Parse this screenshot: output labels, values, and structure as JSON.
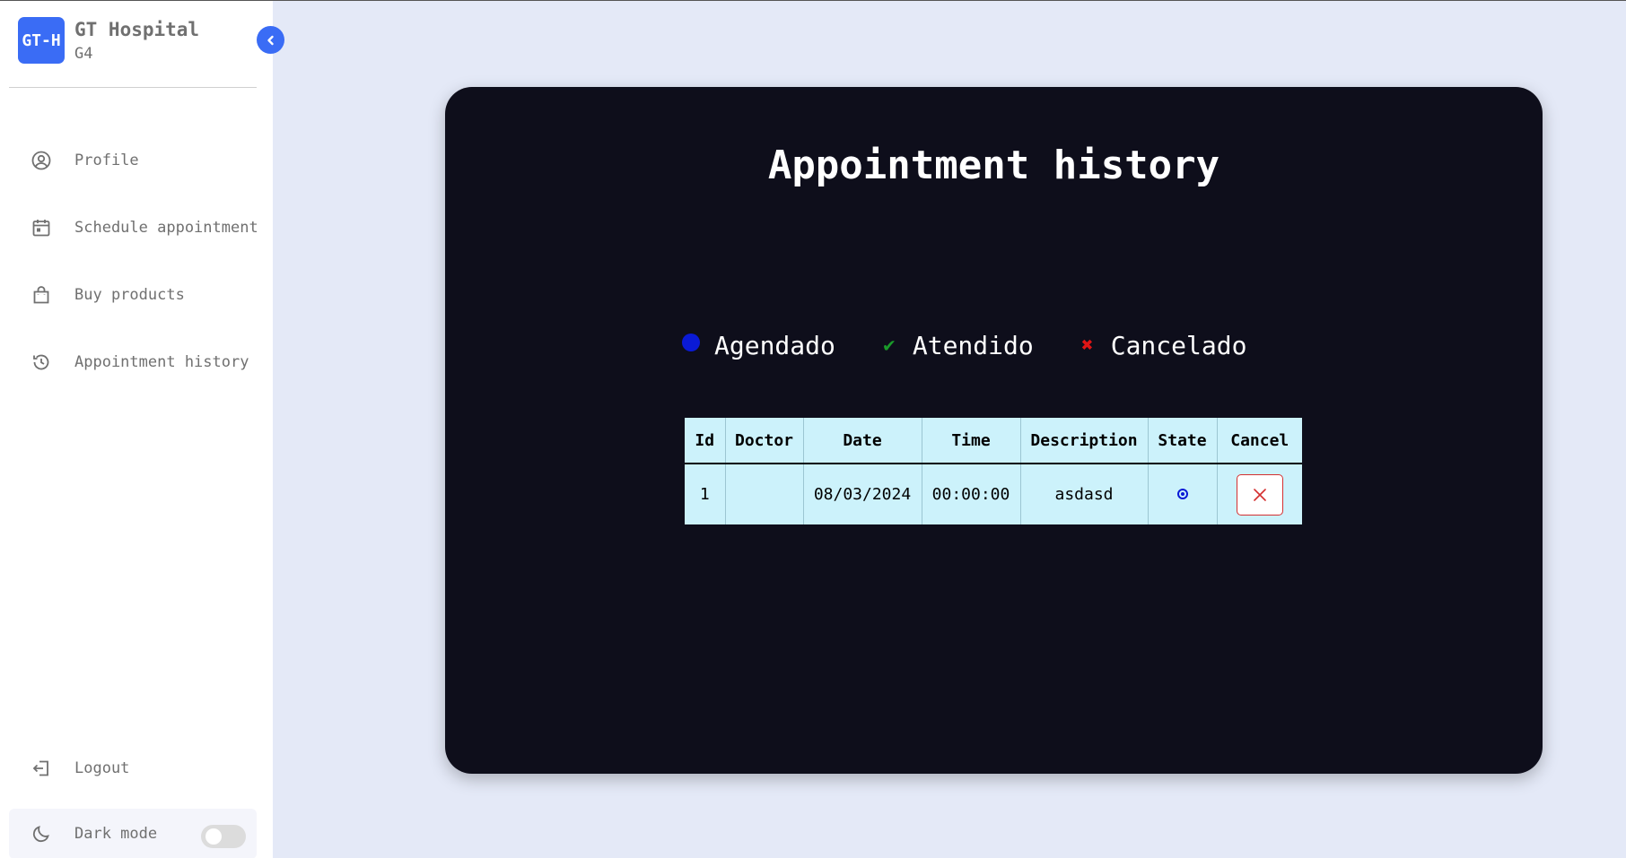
{
  "brand": {
    "logo": "GT-H",
    "name": "GT Hospital",
    "subtitle": "G4"
  },
  "nav": {
    "items": [
      {
        "label": "Profile",
        "icon": "user-circle-icon"
      },
      {
        "label": "Schedule appointment",
        "icon": "calendar-icon"
      },
      {
        "label": "Buy products",
        "icon": "shopping-bag-icon"
      },
      {
        "label": "Appointment history",
        "icon": "history-icon"
      }
    ],
    "logout": "Logout",
    "dark_mode": "Dark mode",
    "dark_mode_on": false
  },
  "main": {
    "title": "Appointment history",
    "legend": [
      {
        "label": "Agendado",
        "color": "#0a1ad6"
      },
      {
        "label": "Atendido",
        "symbol": "✔",
        "color": "#1a9a2a"
      },
      {
        "label": "Cancelado",
        "symbol": "✖",
        "color": "#e01515"
      }
    ],
    "table": {
      "headers": [
        "Id",
        "Doctor",
        "Date",
        "Time",
        "Description",
        "State",
        "Cancel"
      ],
      "rows": [
        {
          "id": "1",
          "doctor": "",
          "date": "08/03/2024",
          "time": "00:00:00",
          "description": "asdasd",
          "state": "agendado"
        }
      ]
    }
  },
  "colors": {
    "accent": "#3a6cf5",
    "card_bg": "#0e0e1b",
    "table_bg": "#ccf2fb",
    "page_bg": "#e4e9f7"
  }
}
